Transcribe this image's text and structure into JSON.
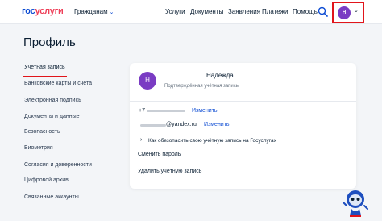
{
  "header": {
    "logo_part1": "гос",
    "logo_part2": "услуги",
    "citizens": "Гражданам",
    "nav": [
      "Услуги",
      "Документы",
      "Заявления",
      "Платежи",
      "Помощь"
    ],
    "avatar_initial": "Н"
  },
  "page": {
    "title": "Профиль"
  },
  "sidebar": {
    "items": [
      "Учётная запись",
      "Банковские карты и счета",
      "Электронная подпись",
      "Документы и данные",
      "Безопасность",
      "Биометрия",
      "Согласия и доверенности",
      "Цифровой архив",
      "Связанные аккаунты"
    ]
  },
  "card": {
    "initial": "Н",
    "name": "Надежда",
    "status": "Подтверждённая учётная запись",
    "phone_prefix": "+7",
    "edit_label": "Изменить",
    "email_domain": "@yandex.ru",
    "secure_text": "Как обезопасить свою учётную запись на Госуслугах",
    "change_password": "Сменить пароль",
    "delete_account": "Удалить учётную запись"
  },
  "colors": {
    "brand_blue": "#0d4cd3",
    "brand_red": "#ee3f58",
    "avatar_purple": "#7a3cc3",
    "highlight_red": "#e1151b"
  },
  "icons": {
    "search": "search-icon",
    "chevron": "chevron-down-icon",
    "assistant": "robot-assistant-icon"
  }
}
